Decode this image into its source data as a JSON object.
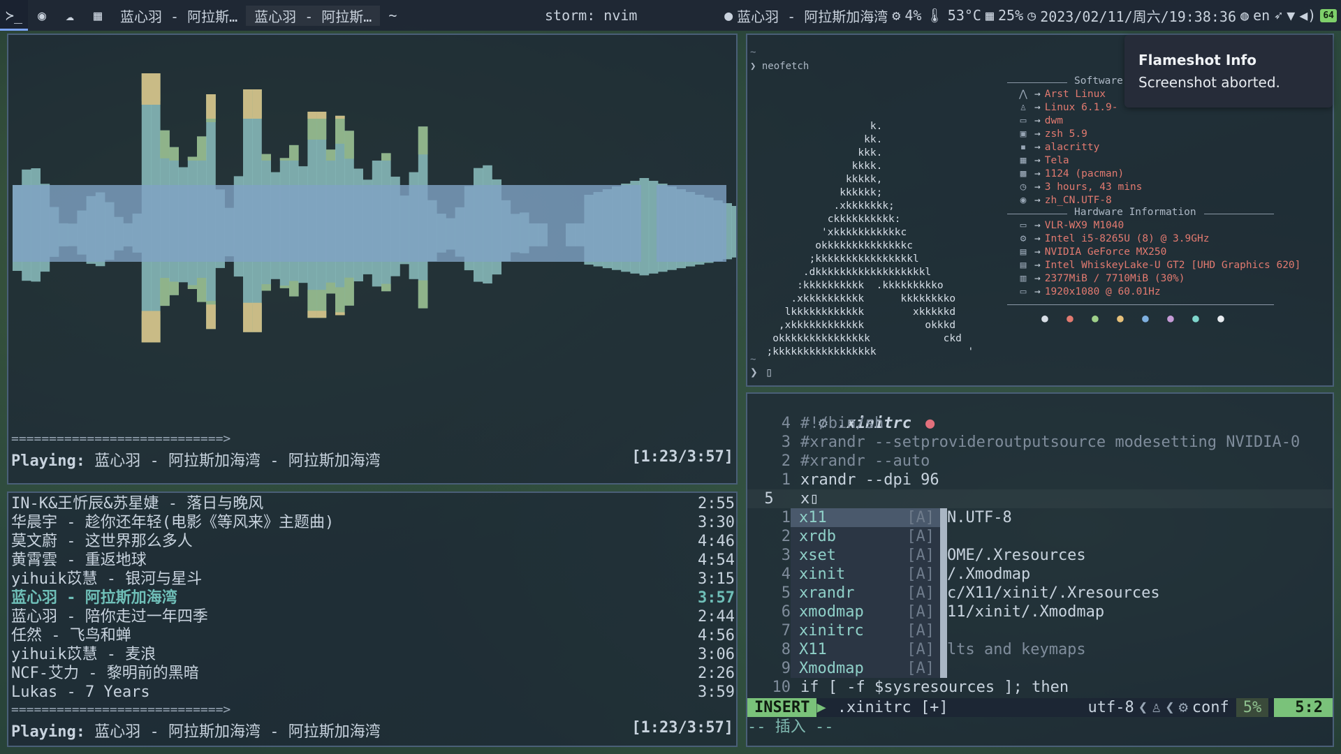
{
  "topbar": {
    "terminal_icon": "terminal-icon",
    "tasks": [
      "蓝心羽 - 阿拉斯…",
      "蓝心羽 - 阿拉斯…"
    ],
    "tilde": "~",
    "window_title": "storm: nvim",
    "now_playing": "蓝心羽 - 阿拉斯加海湾",
    "cpu": "4%",
    "temp": "53°C",
    "mem": "25%",
    "datetime": "2023/02/11/周六/19:38:36",
    "lang": "en",
    "battery": "64"
  },
  "visualizer": {
    "separator": "============================>",
    "playing_label": "Playing:",
    "playing_track": "蓝心羽 - 阿拉斯加海湾 - 阿拉斯加海湾",
    "time": "[1:23/3:57]",
    "colors": {
      "base": "#7fa3c4",
      "mid": "#8cc0c0",
      "green": "#8fb38a",
      "yellow": "#c9bb86",
      "pink": "#b78fa6"
    }
  },
  "playlist": {
    "tracks": [
      {
        "title": "IN-K&王忻辰&苏星婕 - 落日与晚风",
        "duration": "2:55"
      },
      {
        "title": "华晨宇 - 趁你还年轻(电影《等风来》主题曲)",
        "duration": "3:30"
      },
      {
        "title": "莫文蔚 - 这世界那么多人",
        "duration": "4:46"
      },
      {
        "title": "黄霄雲 - 重返地球",
        "duration": "4:54"
      },
      {
        "title": "yihuik苡慧 - 银河与星斗",
        "duration": "3:15"
      },
      {
        "title": "蓝心羽 - 阿拉斯加海湾",
        "duration": "3:57"
      },
      {
        "title": "蓝心羽 - 陪你走过一年四季",
        "duration": "2:44"
      },
      {
        "title": "任然 - 飞鸟和蝉",
        "duration": "4:56"
      },
      {
        "title": "yihuik苡慧 - 麦浪",
        "duration": "3:06"
      },
      {
        "title": "NCF-艾力 - 黎明前的黑暗",
        "duration": "2:26"
      },
      {
        "title": "Lukas - 7 Years",
        "duration": "3:59"
      }
    ],
    "current_index": 5,
    "separator": "============================>",
    "playing_label": "Playing:",
    "playing_track": "蓝心羽 - 阿拉斯加海湾 - 阿拉斯加海湾",
    "time": "[1:23/3:57]"
  },
  "neofetch": {
    "tilde1": "~",
    "prompt": "❯ neofetch",
    "software_header": "Software",
    "hardware_header": "Hardware Information",
    "software": [
      {
        "icon": "arch-icon",
        "glyph": "⋀",
        "value": "Arst Linux"
      },
      {
        "icon": "linux-icon",
        "glyph": "♙",
        "value": "Linux 6.1.9-"
      },
      {
        "icon": "window-icon",
        "glyph": "▭",
        "value": "dwm"
      },
      {
        "icon": "shell-icon",
        "glyph": "▣",
        "value": "zsh 5.9"
      },
      {
        "icon": "terminal-icon",
        "glyph": "▪",
        "value": "alacritty"
      },
      {
        "icon": "grid-icon",
        "glyph": "▦",
        "value": "Tela"
      },
      {
        "icon": "package-icon",
        "glyph": "▩",
        "value": "1124 (pacman)"
      },
      {
        "icon": "clock-icon",
        "glyph": "◷",
        "value": "3 hours, 43 mins"
      },
      {
        "icon": "location-icon",
        "glyph": "◉",
        "value": "zh_CN.UTF-8"
      }
    ],
    "hardware": [
      {
        "icon": "laptop-icon",
        "glyph": "▭",
        "value": "VLR-WX9 M1040"
      },
      {
        "icon": "cpu-icon",
        "glyph": "⚙",
        "value": "Intel i5-8265U (8) @ 3.9GHz"
      },
      {
        "icon": "gpu-icon",
        "glyph": "▤",
        "value": "NVIDIA GeForce MX250"
      },
      {
        "icon": "gpu-icon",
        "glyph": "▤",
        "value": "Intel WhiskeyLake-U GT2 [UHD Graphics 620]"
      },
      {
        "icon": "memory-icon",
        "glyph": "▥",
        "value": "2377MiB / 7710MiB (30%)"
      },
      {
        "icon": "monitor-icon",
        "glyph": "▭",
        "value": "1920x1080 @ 60.01Hz"
      }
    ],
    "drop_colors": [
      "#d8dee6",
      "#e27a70",
      "#9fd08a",
      "#e6c07a",
      "#7fb0e0",
      "#c59bd6",
      "#7fd6cc",
      "#e8ecf0"
    ],
    "tilde2": "~",
    "prompt2": "❯ ▯"
  },
  "notification": {
    "title": "Flameshot Info",
    "body": "Screenshot aborted."
  },
  "vim": {
    "filename": ".xinitrc",
    "lines": [
      {
        "num": "4",
        "text": "#!/bin/sh",
        "comment": true
      },
      {
        "num": "3",
        "text": "#xrandr --setprovideroutputsource modesetting NVIDIA-0",
        "comment": true
      },
      {
        "num": "2",
        "text": "#xrandr --auto",
        "comment": true
      },
      {
        "num": "1",
        "text": "xrandr --dpi 96",
        "comment": false
      },
      {
        "num": "5",
        "text": "x▯",
        "comment": false
      },
      {
        "num": "1",
        "text": "",
        "comment": false
      },
      {
        "num": "2",
        "text": "",
        "comment": false
      },
      {
        "num": "3",
        "text": "",
        "comment": false
      },
      {
        "num": "4",
        "text": "",
        "comment": false
      },
      {
        "num": "5",
        "text": "",
        "comment": false
      },
      {
        "num": "6",
        "text": "",
        "comment": false
      },
      {
        "num": "7",
        "text": "",
        "comment": false
      },
      {
        "num": "8",
        "text": "",
        "comment": false
      },
      {
        "num": "9",
        "text": "",
        "comment": false
      },
      {
        "num": "10",
        "text": "if [ -f $sysresources ]; then",
        "comment": false
      }
    ],
    "behind_text": [
      "N.UTF-8",
      "",
      "OME/.Xresources",
      "/.Xmodmap",
      "c/X11/xinit/.Xresources",
      "11/xinit/.Xmodmap",
      "",
      "lts and keymaps",
      ""
    ],
    "completions": [
      {
        "word": "x11",
        "tag": "[A]"
      },
      {
        "word": "xrdb",
        "tag": "[A]"
      },
      {
        "word": "xset",
        "tag": "[A]"
      },
      {
        "word": "xinit",
        "tag": "[A]"
      },
      {
        "word": "xrandr",
        "tag": "[A]"
      },
      {
        "word": "xmodmap",
        "tag": "[A]"
      },
      {
        "word": "xinitrc",
        "tag": "[A]"
      },
      {
        "word": "X11",
        "tag": "[A]"
      },
      {
        "word": "Xmodmap",
        "tag": "[A]"
      }
    ],
    "status": {
      "mode": "INSERT",
      "file": ".xinitrc [+]",
      "encoding": "utf-8",
      "filetype": "conf",
      "percent": "5%",
      "position": "5:2"
    },
    "cmdline": "-- 插入 --"
  }
}
